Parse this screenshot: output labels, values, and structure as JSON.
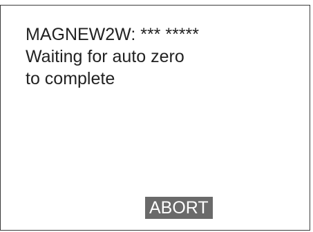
{
  "dialog": {
    "title_line": "MAGNEW2W: *** *****",
    "message_line_1": "Waiting for auto zero",
    "message_line_2": "to complete"
  },
  "actions": {
    "abort_label": "ABORT"
  }
}
